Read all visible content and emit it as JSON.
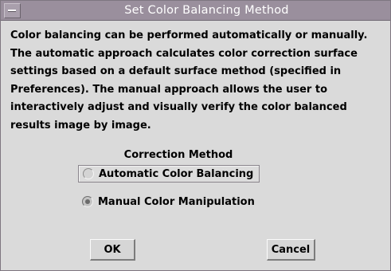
{
  "window": {
    "title": "Set Color Balancing Method",
    "menu_icon": "window-menu-icon"
  },
  "description": {
    "lines": [
      "Color balancing can be performed automatically or manually.",
      "The automatic approach calculates color correction surface",
      "settings based on a default surface method (specified in",
      "Preferences). The manual approach allows the user to",
      "interactively adjust and visually verify the color balanced",
      "results image by image."
    ]
  },
  "correction_method": {
    "label": "Correction Method",
    "options": [
      {
        "label": "Automatic Color Balancing",
        "selected": false,
        "focused": true
      },
      {
        "label": "Manual Color Manipulation",
        "selected": true,
        "focused": false
      }
    ]
  },
  "buttons": {
    "ok": "OK",
    "cancel": "Cancel"
  },
  "colors": {
    "titlebar": "#9a8f9d",
    "background": "#dadada"
  }
}
